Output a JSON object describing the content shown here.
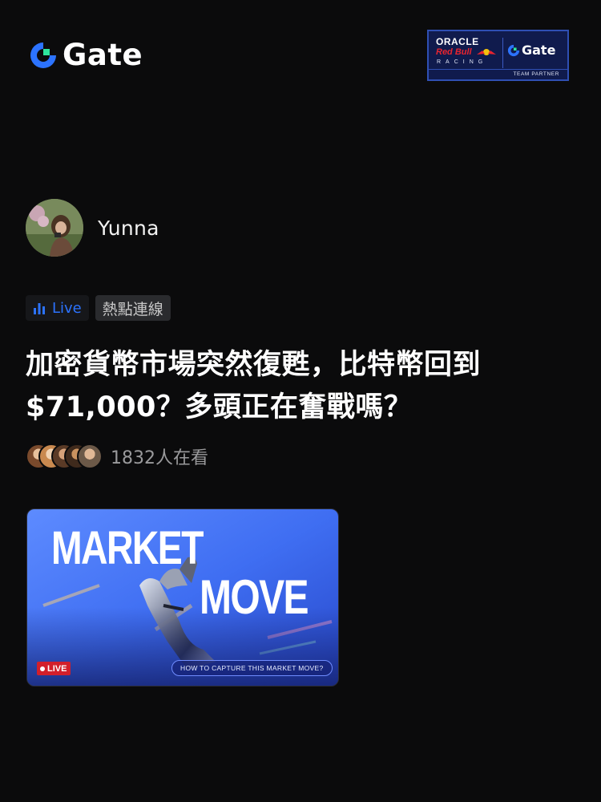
{
  "header": {
    "logo_text": "Gate",
    "logo_icon": "gate-logo-icon",
    "partner": {
      "oracle": "ORACLE",
      "redbull": "Red Bull",
      "racing": "RACING",
      "gate": "Gate",
      "footer": "TEAM PARTNER",
      "bg_color": "#101b4d"
    }
  },
  "post": {
    "author": {
      "name": "Yunna",
      "avatar_icon": "user-avatar"
    },
    "tags": {
      "live_label": "Live",
      "live_icon": "bar-chart-icon",
      "topic": "熱點連線"
    },
    "title": "加密貨幣市場突然復甦，比特幣回到 $71,000？多頭正在奮戰嗎？",
    "viewers": {
      "count_text": "1832人在看"
    },
    "thumbnail": {
      "line1": "MARKET",
      "line2": "MOVE",
      "live_badge": "LIVE",
      "caption": "HOW TO CAPTURE THIS MARKET MOVE?"
    }
  },
  "colors": {
    "background": "#0b0b0c",
    "accent": "#2c73ff",
    "live_red": "#d21f2b"
  }
}
